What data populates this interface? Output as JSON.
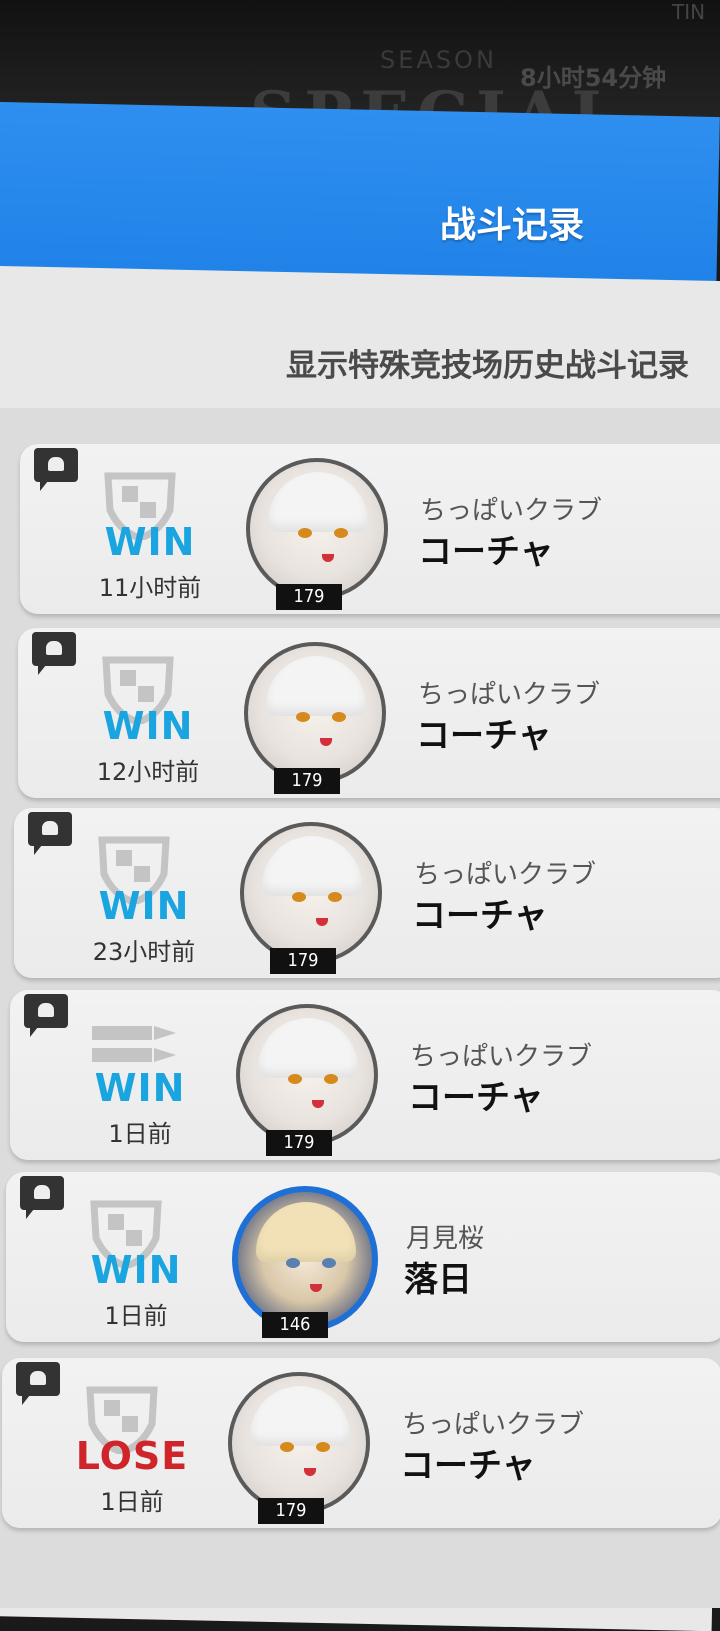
{
  "background": {
    "corner_text": "TIN",
    "season_label": "SEASON",
    "countdown": "8小时54分钟",
    "arena_title": "SPECIAL ARENA"
  },
  "header": {
    "title": "战斗记录"
  },
  "subtitle": "显示特殊竞技场历史战斗记录",
  "colors": {
    "win": "#1aa5e0",
    "lose": "#d0242b",
    "header": "#2286ec"
  },
  "records": [
    {
      "result": "WIN",
      "time": "11小时前",
      "guild": "ちっぱいクラブ",
      "player": "コーチャ",
      "level": "179",
      "mode_icon": "shield-icon"
    },
    {
      "result": "WIN",
      "time": "12小时前",
      "guild": "ちっぱいクラブ",
      "player": "コーチャ",
      "level": "179",
      "mode_icon": "shield-icon"
    },
    {
      "result": "WIN",
      "time": "23小时前",
      "guild": "ちっぱいクラブ",
      "player": "コーチャ",
      "level": "179",
      "mode_icon": "shield-icon"
    },
    {
      "result": "WIN",
      "time": "1日前",
      "guild": "ちっぱいクラブ",
      "player": "コーチャ",
      "level": "179",
      "mode_icon": "bullets-icon"
    },
    {
      "result": "WIN",
      "time": "1日前",
      "guild": "月見桜",
      "player": "落日",
      "level": "146",
      "mode_icon": "shield-icon"
    },
    {
      "result": "LOSE",
      "time": "1日前",
      "guild": "ちっぱいクラブ",
      "player": "コーチャ",
      "level": "179",
      "mode_icon": "shield-icon"
    }
  ]
}
